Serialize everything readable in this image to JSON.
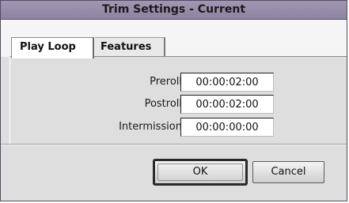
{
  "window": {
    "title": "Trim Settings - Current"
  },
  "tabs": [
    {
      "label": "Play Loop",
      "active": true
    },
    {
      "label": "Features",
      "active": false
    }
  ],
  "fields": [
    {
      "label": "Preroll",
      "value": "00:00:02:00"
    },
    {
      "label": "Postroll",
      "value": "00:00:02:00"
    },
    {
      "label": "Intermission",
      "value": "00:00:00:00"
    }
  ],
  "buttons": {
    "ok_label": "OK",
    "cancel_label": "Cancel"
  },
  "colors": {
    "titlebar": "#9a90ad",
    "dialog_bg": "#dedede",
    "tabbar_bg": "#f5f5f5"
  }
}
